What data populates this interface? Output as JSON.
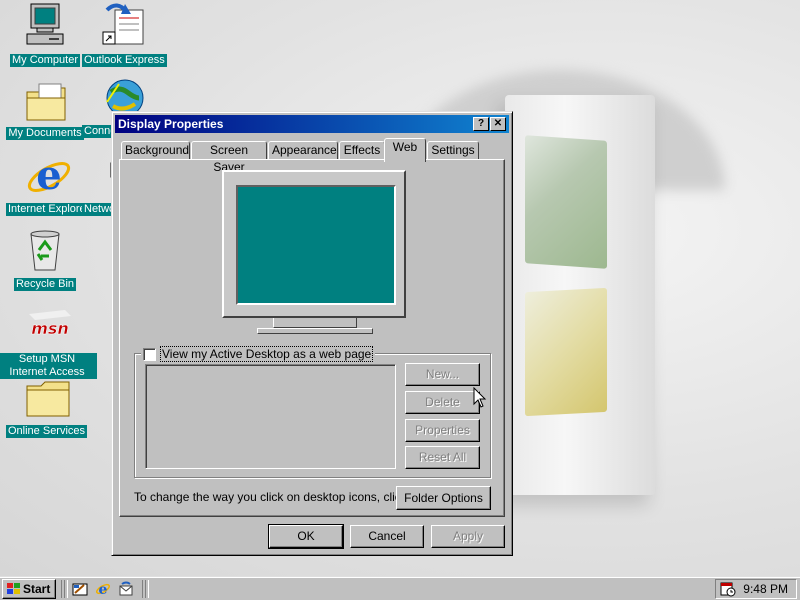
{
  "desktop": {
    "icons": [
      {
        "label": "My Computer"
      },
      {
        "label": "Outlook Express"
      },
      {
        "label": "My Documents"
      },
      {
        "label": "Connect to the Internet",
        "visible_label": "Conn In"
      },
      {
        "label": "Internet Explorer"
      },
      {
        "label": "Network Neighborhood",
        "visible_label": "Ne Neigh"
      },
      {
        "label": "Recycle Bin"
      },
      {
        "label": "Setup MSN Internet Access"
      },
      {
        "label": "Online Services"
      }
    ],
    "colors": {
      "icon_label_bg": "#008080",
      "wallpaper": "#e2e2e2"
    }
  },
  "window": {
    "title": "Display Properties",
    "help_glyph": "?",
    "close_glyph": "✕",
    "tabs": [
      "Background",
      "Screen Saver",
      "Appearance",
      "Effects",
      "Web",
      "Settings"
    ],
    "active_tab": "Web",
    "web": {
      "checkbox_label": "View my Active Desktop as a web page",
      "checked": false,
      "side_buttons": [
        "New...",
        "Delete",
        "Properties",
        "Reset All"
      ],
      "hint": "To change the way you click on desktop icons, click:",
      "folder_options": "Folder Options"
    },
    "buttons": {
      "ok": "OK",
      "cancel": "Cancel",
      "apply": "Apply"
    },
    "colors": {
      "title_start": "#000080",
      "title_end": "#1084d0",
      "screen": "#008080"
    }
  },
  "taskbar": {
    "start_label": "Start",
    "clock": "9:48 PM"
  }
}
